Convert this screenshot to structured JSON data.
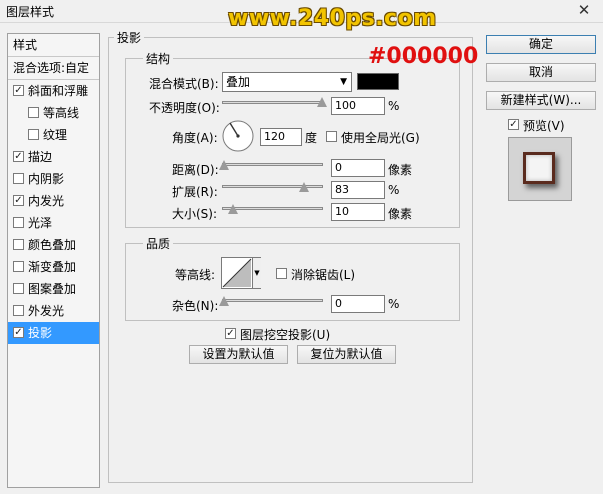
{
  "window": {
    "title": "图层样式",
    "close_glyph": "✕"
  },
  "watermark": "www.240ps.com",
  "color_note": "#000000",
  "left_list": {
    "header": "样式",
    "blend_options": "混合选项:自定",
    "items": [
      {
        "label": "斜面和浮雕",
        "checked": true
      },
      {
        "label": "等高线",
        "checked": false
      },
      {
        "label": "纹理",
        "checked": false
      },
      {
        "label": "描边",
        "checked": true
      },
      {
        "label": "内阴影",
        "checked": false
      },
      {
        "label": "内发光",
        "checked": true
      },
      {
        "label": "光泽",
        "checked": false
      },
      {
        "label": "颜色叠加",
        "checked": false
      },
      {
        "label": "渐变叠加",
        "checked": false
      },
      {
        "label": "图案叠加",
        "checked": false
      },
      {
        "label": "外发光",
        "checked": false
      },
      {
        "label": "投影",
        "checked": true
      }
    ]
  },
  "section_title": "投影",
  "structure": {
    "title": "结构",
    "blend_mode_label": "混合模式(B):",
    "blend_mode_value": "叠加",
    "blend_color": "#000000",
    "opacity_label": "不透明度(O):",
    "opacity_value": "100",
    "opacity_unit": "%",
    "angle_label": "角度(A):",
    "angle_value": "120",
    "angle_unit": "度",
    "global_light_label": "使用全局光(G)",
    "distance_label": "距离(D):",
    "distance_value": "0",
    "distance_unit": "像素",
    "spread_label": "扩展(R):",
    "spread_value": "83",
    "spread_unit": "%",
    "size_label": "大小(S):",
    "size_value": "10",
    "size_unit": "像素"
  },
  "quality": {
    "title": "品质",
    "contour_label": "等高线:",
    "anti_alias_label": "消除锯齿(L)",
    "noise_label": "杂色(N):",
    "noise_value": "0",
    "noise_unit": "%"
  },
  "knockout_label": "图层挖空投影(U)",
  "make_default": "设置为默认值",
  "reset_default": "复位为默认值",
  "buttons": {
    "ok": "确定",
    "cancel": "取消",
    "new_style": "新建样式(W)...",
    "preview": "预览(V)"
  }
}
